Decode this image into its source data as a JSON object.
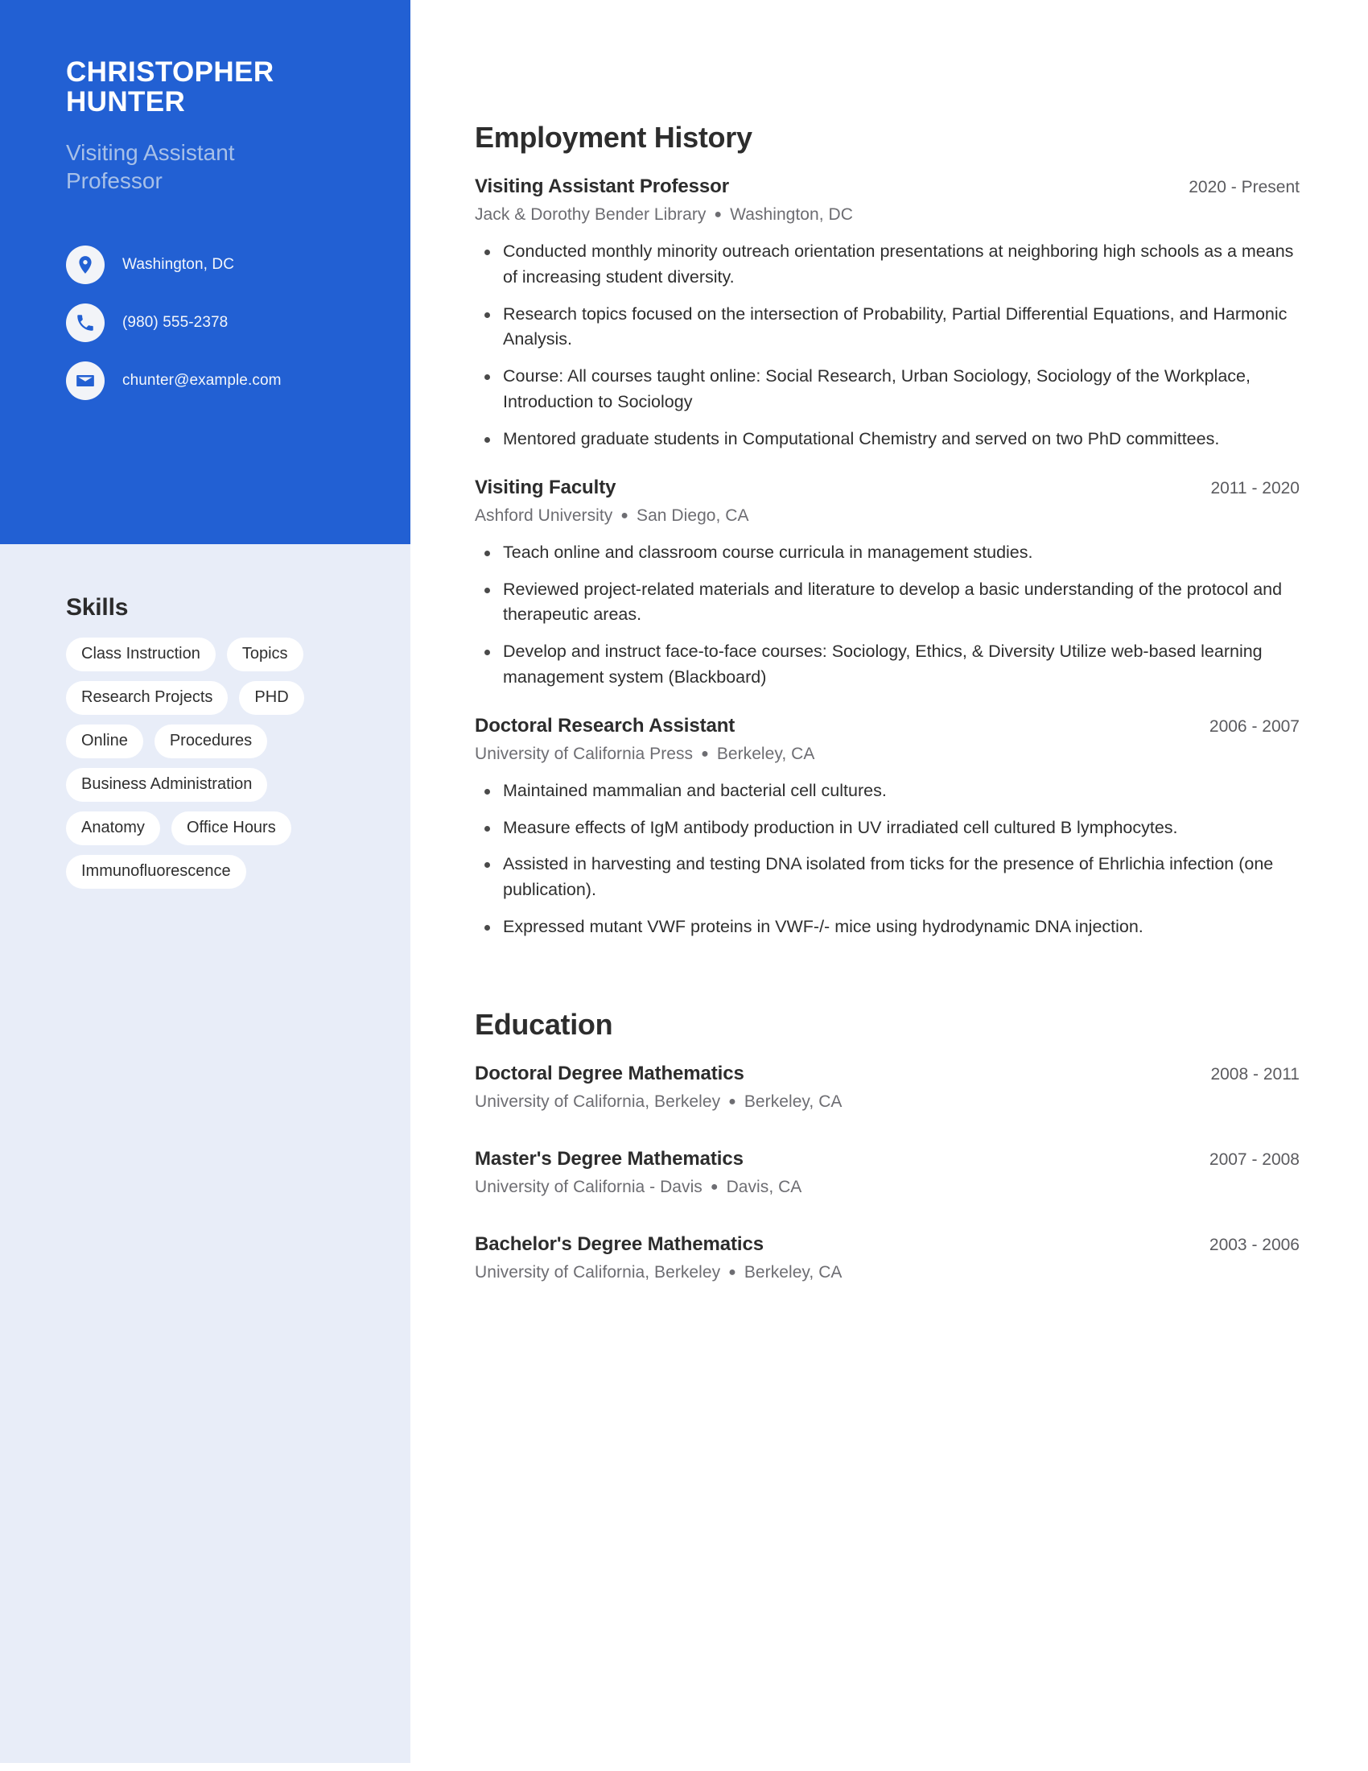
{
  "theme": {
    "accent": "#2260D3",
    "sidebar_bg": "#E8EDF8",
    "tag_bg": "#FFFFFF",
    "heading_color": "#2D2D2D",
    "muted_text": "#6D6D72",
    "role_color": "#A7C0E8"
  },
  "sidebar": {
    "name": "CHRISTOPHER HUNTER",
    "role": "Visiting Assistant Professor",
    "contact": [
      {
        "icon": "location-pin-icon",
        "value": "Washington, DC"
      },
      {
        "icon": "phone-icon",
        "value": "(980) 555-2378"
      },
      {
        "icon": "envelope-icon",
        "value": "chunter@example.com"
      }
    ],
    "skills": {
      "title": "Skills",
      "tags": [
        "Class Instruction",
        "Topics",
        "Research Projects",
        "PHD",
        "Online",
        "Procedures",
        "Business Administration",
        "Anatomy",
        "Office Hours",
        "Immunofluorescence"
      ]
    }
  },
  "main": {
    "employment": {
      "heading": "Employment History",
      "entries": [
        {
          "title": "Visiting Assistant Professor",
          "date": "2020 - Present",
          "organization": "Jack & Dorothy Bender Library",
          "location": "Washington, DC",
          "bullets": [
            "Conducted monthly minority outreach orientation presentations at neighboring high schools as a means of increasing student diversity.",
            "Research topics focused on the intersection of Probability, Partial Differential Equations, and Harmonic Analysis.",
            "Course: All courses taught online: Social Research, Urban Sociology, Sociology of the Workplace, Introduction to Sociology",
            "Mentored graduate students in Computational Chemistry and served on two PhD committees."
          ]
        },
        {
          "title": "Visiting Faculty",
          "date": "2011 - 2020",
          "organization": "Ashford University",
          "location": "San Diego, CA",
          "bullets": [
            "Teach online and classroom course curricula in management studies.",
            "Reviewed project-related materials and literature to develop a basic understanding of the protocol and therapeutic areas.",
            "Develop and instruct face-to-face courses: Sociology, Ethics, & Diversity Utilize web-based learning management system (Blackboard)"
          ]
        },
        {
          "title": "Doctoral Research Assistant",
          "date": "2006 - 2007",
          "organization": "University of California Press",
          "location": "Berkeley, CA",
          "bullets": [
            "Maintained mammalian and bacterial cell cultures.",
            "Measure effects of IgM antibody production in UV irradiated cell cultured B lymphocytes.",
            "Assisted in harvesting and testing DNA isolated from ticks for the presence of Ehrlichia infection (one publication).",
            "Expressed mutant VWF proteins in VWF-/- mice using hydrodynamic DNA injection."
          ]
        }
      ]
    },
    "education": {
      "heading": "Education",
      "entries": [
        {
          "title": "Doctoral Degree Mathematics",
          "date": "2008 - 2011",
          "organization": "University of California, Berkeley",
          "location": "Berkeley, CA"
        },
        {
          "title": "Master's Degree Mathematics",
          "date": "2007 - 2008",
          "organization": "University of California - Davis",
          "location": "Davis, CA"
        },
        {
          "title": "Bachelor's Degree Mathematics",
          "date": "2003 - 2006",
          "organization": "University of California, Berkeley",
          "location": "Berkeley, CA"
        }
      ]
    }
  }
}
